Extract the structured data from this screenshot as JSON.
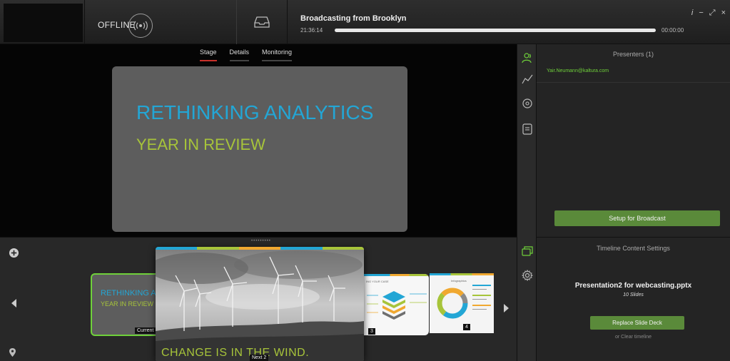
{
  "header": {
    "status_label": "OFFLINE",
    "broadcast_title": "Broadcasting from Brooklyn",
    "clock": "21:36:14",
    "duration": "00:00:00",
    "progress": 1.0,
    "window_controls": [
      "i",
      "−",
      "⤢",
      "×"
    ]
  },
  "stage": {
    "tabs": [
      {
        "label": "Stage",
        "active": true
      },
      {
        "label": "Details",
        "active": false
      },
      {
        "label": "Monitoring",
        "active": false
      }
    ],
    "slide": {
      "title": "RETHINKING ANALYTICS",
      "subtitle": "YEAR IN REVIEW"
    }
  },
  "tools": {
    "icons": [
      "presenters-icon",
      "analytics-icon",
      "chat-icon",
      "notes-icon",
      "slides-icon",
      "settings-icon"
    ]
  },
  "presenters": {
    "heading": "Presenters (1)",
    "items": [
      "Yair.Neumann@kaltura.com"
    ],
    "setup_button": "Setup for Broadcast"
  },
  "timeline": {
    "drag_handle": "•••••••••",
    "current": {
      "title": "RETHINKING A",
      "subtitle": "YEAR IN REVIEW",
      "badge": "Current"
    },
    "next2": {
      "caption": "CHANGE IS IN THE WIND.",
      "badge": "Next 2"
    },
    "slide3": {
      "title": "ING YOUR CASE",
      "badge": "3"
    },
    "slide4": {
      "title": "Infographics",
      "badge": "4"
    }
  },
  "timeline_settings": {
    "heading": "Timeline Content Settings",
    "presentation_name": "Presentation2 for webcasting.pptx",
    "slide_count": "10 Slides",
    "replace_button": "Replace Slide Deck",
    "clear_link": "or Clear timeline"
  },
  "colors": {
    "accent_green": "#5a8a3a",
    "title_blue": "#23a6d5",
    "subtitle_green": "#a7c43a",
    "active_tab": "#c8302a"
  }
}
